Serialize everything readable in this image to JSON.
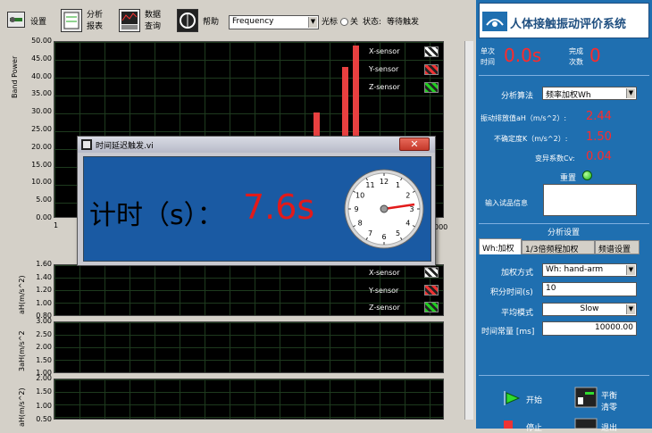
{
  "toolbar": {
    "settings_label": "设置",
    "analysis_label_1": "分析",
    "analysis_label_2": "报表",
    "data_label_1": "数据",
    "data_label_2": "查询",
    "help_label": "帮助",
    "domain_select": "Frequency",
    "cursor_label": "光标",
    "cursor_state": "关",
    "status_label": "状态:",
    "status_value": "等待触发"
  },
  "plot_main": {
    "ylabel": "Band Power",
    "yticks": [
      "50.00",
      "45.00",
      "40.00",
      "35.00",
      "30.00",
      "25.00",
      "20.00",
      "15.00",
      "10.00",
      "5.00",
      "0.00"
    ],
    "x_first": "1",
    "x_last": "000",
    "legend": [
      "X-sensor",
      "Y-sensor",
      "Z-sensor"
    ]
  },
  "plot_x": {
    "ylabel": "aH(m/s^2)",
    "yticks": [
      "1.60",
      "1.40",
      "1.20",
      "1.00",
      "0.80"
    ],
    "legend": [
      "X-sensor",
      "Y-sensor",
      "Z-sensor"
    ]
  },
  "plot_y": {
    "ylabel": "3aH(m/s^2",
    "yticks": [
      "3.00",
      "2.50",
      "2.00",
      "1.50",
      "1.00"
    ]
  },
  "plot_z": {
    "ylabel": "aH(m/s^2)",
    "yticks": [
      "2.00",
      "1.50",
      "1.00",
      "0.50"
    ]
  },
  "chart_data": {
    "type": "bar",
    "values": [
      30,
      43,
      49
    ],
    "ylim": [
      0,
      50
    ],
    "ylabel": "Band Power"
  },
  "right_panel": {
    "title": "人体接触振动评价系统",
    "single_time_label_1": "单次",
    "single_time_label_2": "时间",
    "single_time_value": "0.0s",
    "done_label_1": "完成",
    "done_label_2": "次数",
    "done_value": "0",
    "algo_label": "分析算法",
    "algo_value": "频率加权Wh",
    "ah_label": "振动排放值aH（m/s^2）:",
    "ah_value": "2.44",
    "k_label": "不确定度K（m/s^2）:",
    "k_value": "1.50",
    "cv_label": "变异系数Cv:",
    "cv_value": "0.04",
    "reset_label": "重置",
    "sample_info_label": "输入试品信息",
    "analysis_settings": "分析设置",
    "tabs": [
      "Wh:加权",
      "1/3倍频程加权",
      "频谱设置"
    ],
    "weight_mode_label": "加权方式",
    "weight_mode_value": "Wh: hand-arm",
    "integ_time_label": "积分时间(s)",
    "integ_time_value": "10",
    "avg_mode_label": "平均模式",
    "avg_mode_value": "Slow",
    "time_const_label": "时间常量 [ms]",
    "time_const_value": "10000.00",
    "start_label": "开始",
    "balance_label_1": "平衡",
    "balance_label_2": "清零",
    "stop_label": "停止",
    "exit_label": "退出"
  },
  "dialog": {
    "title": "时间延迟触发.vi",
    "timer_label": "计时（s）：",
    "timer_value": "7.6s",
    "gauge_ticks": [
      "1",
      "2",
      "3",
      "4",
      "5",
      "6",
      "7",
      "8",
      "9",
      "10",
      "11",
      "12"
    ]
  },
  "colors": {
    "panel_blue": "#1f6fb0",
    "value_red": "#ff2a2a",
    "bar_red": "#e84040"
  }
}
